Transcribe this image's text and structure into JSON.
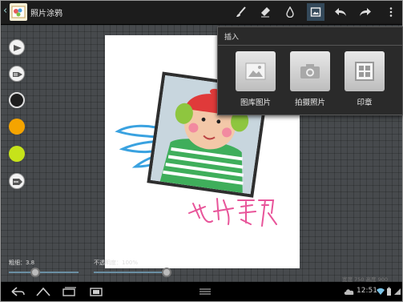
{
  "app": {
    "title": "照片涂鸦"
  },
  "toolbar": {
    "items": [
      {
        "name": "brush-icon",
        "active": false
      },
      {
        "name": "eraser-icon",
        "active": false
      },
      {
        "name": "ink-drop-icon",
        "active": false
      },
      {
        "name": "insert-image-icon",
        "active": true
      },
      {
        "name": "undo-icon",
        "active": false
      },
      {
        "name": "redo-icon",
        "active": false
      },
      {
        "name": "overflow-menu-icon",
        "active": false
      }
    ]
  },
  "tools": {
    "colors": [
      "#1e1e1e",
      "#f5a400",
      "#c6e31a"
    ]
  },
  "insert_popup": {
    "title": "插入",
    "items": [
      {
        "label": "图库图片",
        "icon": "gallery-icon"
      },
      {
        "label": "拍摄照片",
        "icon": "camera-icon"
      },
      {
        "label": "印章",
        "icon": "stamp-icon"
      }
    ]
  },
  "sliders": {
    "thickness_label": "粗细：3.8",
    "opacity_label": "不透明度：100%",
    "thickness_value": 3.8,
    "opacity_percent": 100
  },
  "canvas_size": {
    "text": "宽度 750  高度 900"
  },
  "statusbar": {
    "time": "12:51"
  }
}
